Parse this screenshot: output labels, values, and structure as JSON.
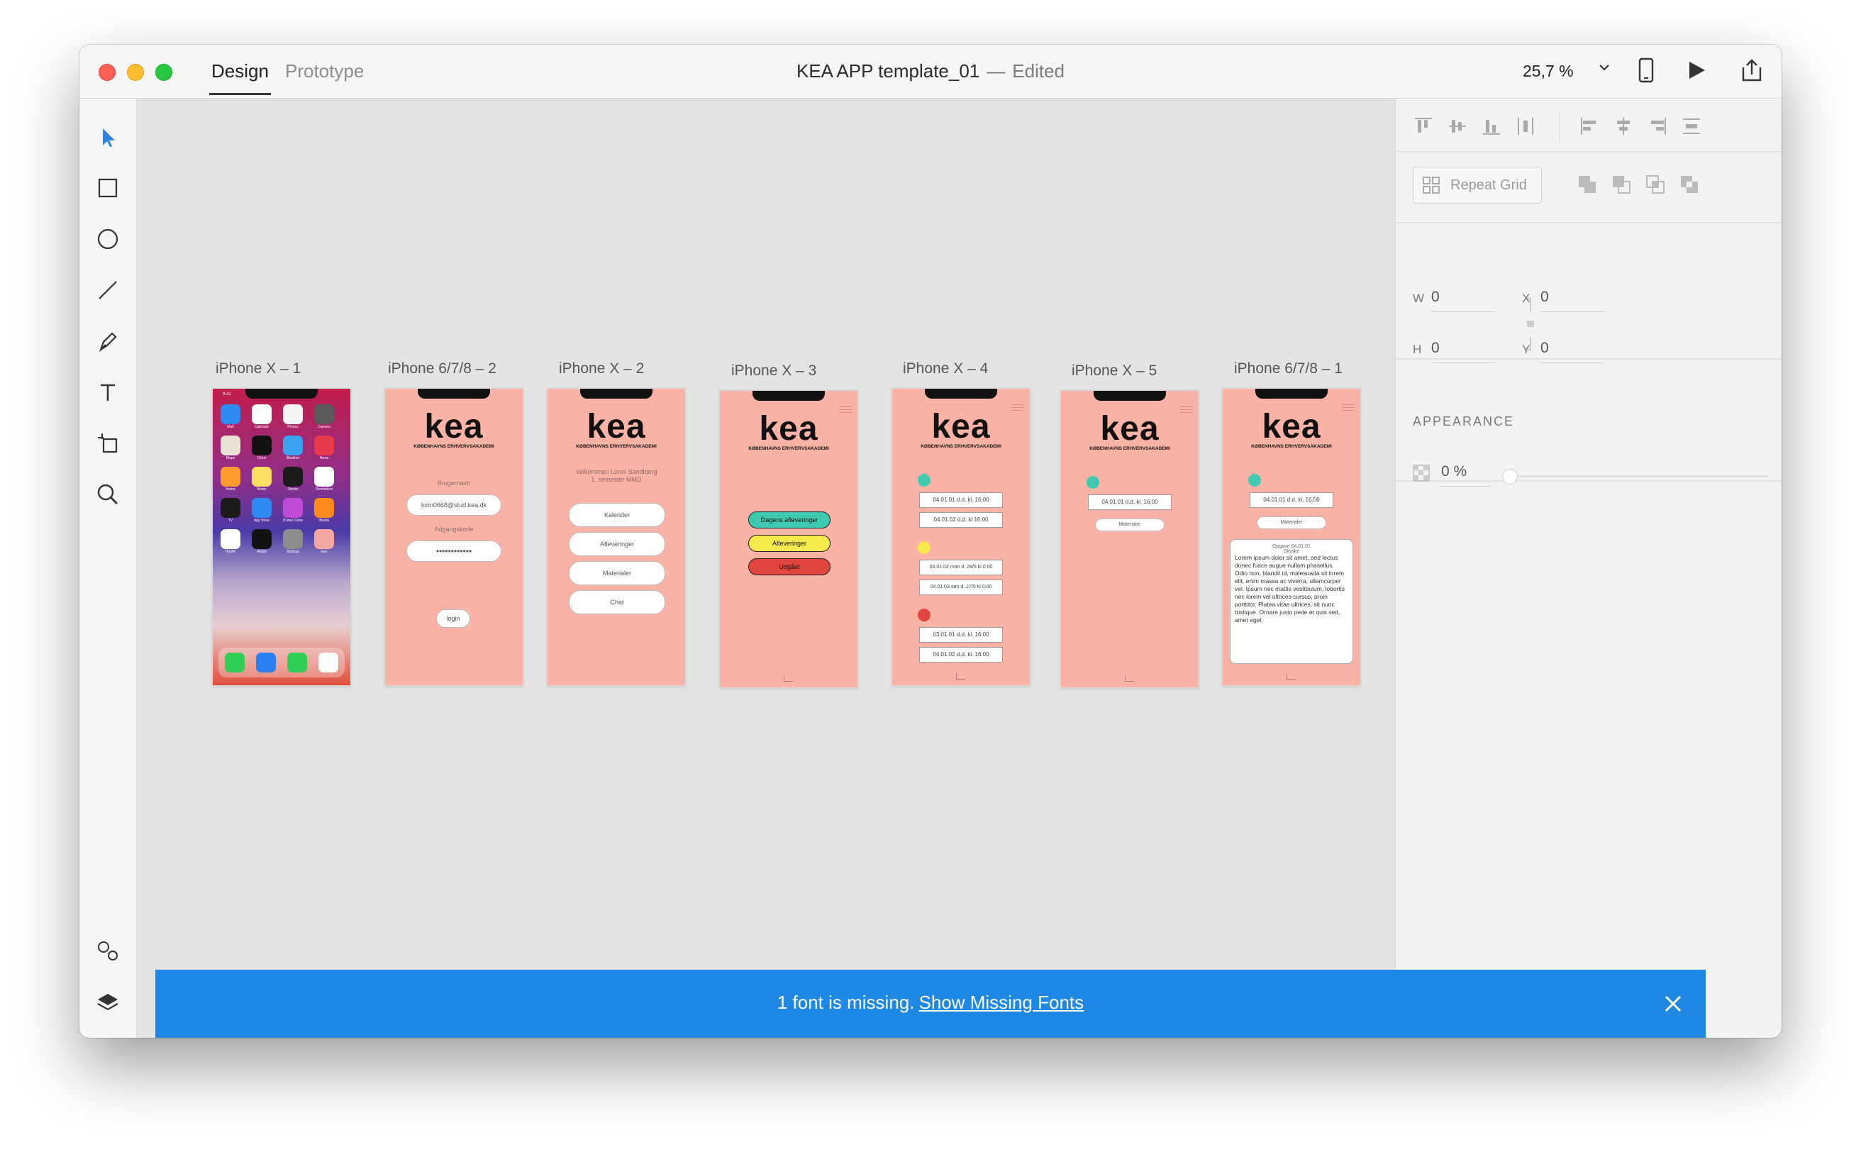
{
  "window": {
    "tabs": [
      {
        "label": "Design",
        "active": true
      },
      {
        "label": "Prototype",
        "active": false
      }
    ],
    "document_title": "KEA APP template_01",
    "title_separator": "—",
    "status": "Edited",
    "zoom": "25,7 %"
  },
  "toolbar": {
    "tools": [
      "select-icon",
      "rectangle-icon",
      "ellipse-icon",
      "line-icon",
      "pen-icon",
      "text-icon",
      "artboard-icon",
      "zoom-icon"
    ],
    "bottom_tools": [
      "assets-icon",
      "layers-icon"
    ]
  },
  "artboards": [
    {
      "label": "iPhone X – 1",
      "kind": "ios-home"
    },
    {
      "label": "iPhone 6/7/8 – 2",
      "kind": "login"
    },
    {
      "label": "iPhone X – 2",
      "kind": "menu"
    },
    {
      "label": "iPhone X – 3",
      "kind": "status"
    },
    {
      "label": "iPhone X – 4",
      "kind": "list"
    },
    {
      "label": "iPhone X – 5",
      "kind": "single"
    },
    {
      "label": "iPhone 6/7/8 – 1",
      "kind": "detail"
    }
  ],
  "screens": {
    "logo": "kea",
    "logo_sub": "KØBENHAVNS ERHVERVSAKADEMI",
    "ios_apps": [
      "Mail",
      "Calendar",
      "Photos",
      "Camera",
      "Maps",
      "Clock",
      "Weather",
      "News",
      "Home",
      "Notes",
      "Stocks",
      "Reminders",
      "TV",
      "App Store",
      "iTunes Store",
      "iBooks",
      "Health",
      "Wallet",
      "Settings",
      "kea"
    ],
    "ios_time": "9:41",
    "ios_date_number": "12",
    "login": {
      "username_label": "Brugernavn",
      "username_value": "lonn0668@stud.kea.dk",
      "password_label": "Adgangskode",
      "password_value": "••••••••••••",
      "login_button": "login"
    },
    "menu": {
      "welcome_line1": "Velkommen Lonni Sandbjerg",
      "welcome_line2": "1. semester MMD",
      "buttons": [
        "Kalender",
        "Afleveringer",
        "Materialer",
        "Chat"
      ]
    },
    "status": {
      "buttons": [
        "Dagens afleveringer",
        "Afleveringer",
        "Udgået"
      ]
    },
    "list": {
      "items": [
        "04.01.01 d.d. kl. 16:00",
        "04.01.02 d.d. kl 16:00",
        "04.01.04 man d. 28/5 kl 0:00",
        "04.01.03 søn d. 27/5 kl 0:00",
        "03.01.01 d.d. kl. 16:00",
        "04.01.02 d.d. kl. 16:00"
      ]
    },
    "single": {
      "item": "04.01.01 d.d. kl. 16:00",
      "button": "Materialer"
    },
    "detail": {
      "item": "04.01.01 d.d. kl. 16:00",
      "button": "Materialer",
      "card_title": "Opgave 04.01.01",
      "card_subtitle": "Skyske",
      "card_body": "Lorem ipsum dolor sit amet, sed lectus donec fusce augue nullam phasellus. Odio non, blandit id, malesuada sit lorem elit, enim massa ac viverra, ullamcorper vel. Ipsum nec mattis vestibulum, lobortis nec lorem vel ultrices cursus, proin porttitor. Platea vitae ultrices, sit nunc tristique. Ornare justo pede et quis sed, amet eget"
    }
  },
  "right_panel": {
    "repeat_grid_label": "Repeat Grid",
    "w_label": "W",
    "w_value": "0",
    "h_label": "H",
    "h_value": "0",
    "x_label": "X",
    "x_value": "0",
    "y_label": "Y",
    "y_value": "0",
    "appearance_label": "APPEARANCE",
    "opacity_value": "0 %"
  },
  "banner": {
    "message": "1 font is missing.",
    "link": "Show Missing Fonts"
  },
  "colors": {
    "artboard_bg": "#fbb3a6",
    "teal": "#3fc9b0",
    "yellow": "#f5ea4b",
    "red": "#e0463e",
    "banner": "#1f88e5"
  }
}
